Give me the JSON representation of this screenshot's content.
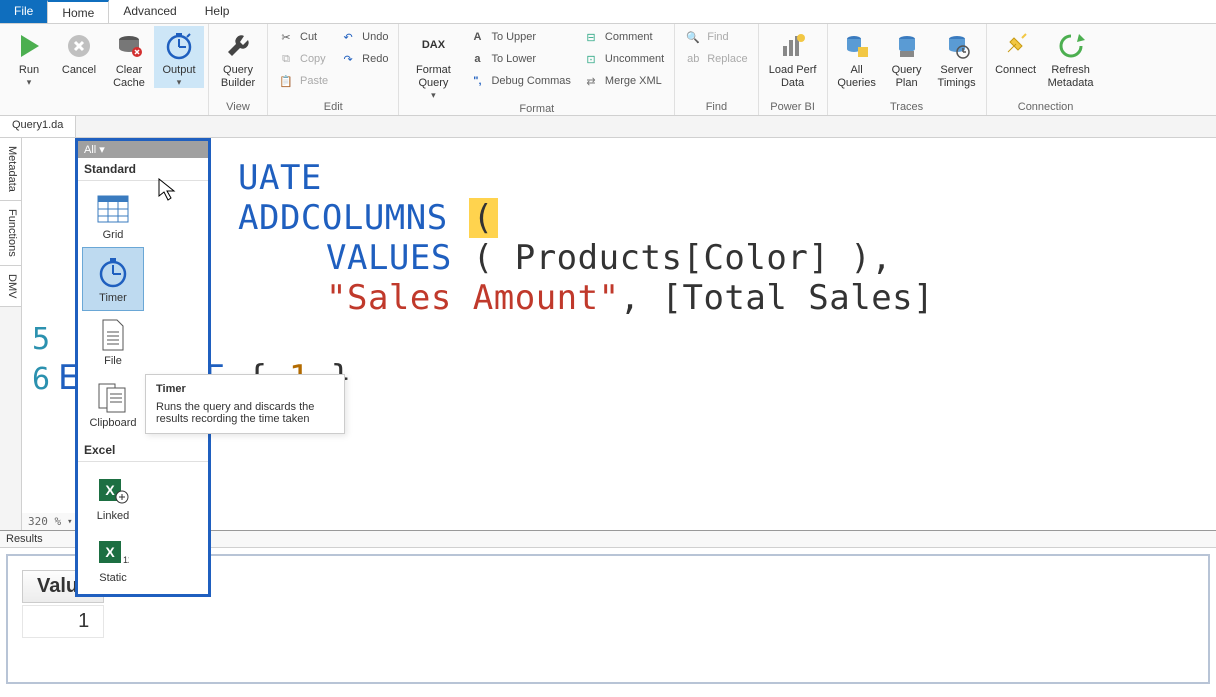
{
  "menu": {
    "file": "File",
    "home": "Home",
    "advanced": "Advanced",
    "help": "Help"
  },
  "ribbon": {
    "run": "Run",
    "cancel": "Cancel",
    "clear_cache": "Clear\nCache",
    "output": "Output",
    "query_builder": "Query\nBuilder",
    "view_group": "View",
    "cut": "Cut",
    "copy": "Copy",
    "paste": "Paste",
    "undo": "Undo",
    "redo": "Redo",
    "edit_group": "Edit",
    "format_query": "Format\nQuery",
    "to_upper": "To Upper",
    "to_lower": "To Lower",
    "debug_commas": "Debug Commas",
    "comment": "Comment",
    "uncomment": "Uncomment",
    "merge_xml": "Merge XML",
    "format_group": "Format",
    "find": "Find",
    "replace": "Replace",
    "find_group": "Find",
    "load_perf": "Load Perf\nData",
    "powerbi_group": "Power BI",
    "all_queries": "All\nQueries",
    "query_plan": "Query\nPlan",
    "server_timings": "Server\nTimings",
    "traces_group": "Traces",
    "connect": "Connect",
    "refresh_meta": "Refresh\nMetadata",
    "connection_group": "Connection"
  },
  "dropdown": {
    "all": "All ▾",
    "standard": "Standard",
    "grid": "Grid",
    "timer": "Timer",
    "file": "File",
    "clipboard": "Clipboard",
    "excel": "Excel",
    "linked": "Linked",
    "static": "Static"
  },
  "tooltip": {
    "title": "Timer",
    "body": "Runs the query and discards the results recording the time taken"
  },
  "tabs": {
    "query1": "Query1.da"
  },
  "side": {
    "metadata": "Metadata",
    "functions": "Functions",
    "dmv": "DMV"
  },
  "code": {
    "l1_uate": "UATE",
    "l2_addcolumns": "ADDCOLUMNS",
    "l3_values": "VALUES",
    "l3_rest": " ( Products[Color] ),",
    "l4_str": "\"Sales Amount\"",
    "l4_rest": ", [Total Sales]",
    "l6_eval": "EVALUATE",
    "l6_brace_open": " { ",
    "l6_num": "1",
    "l6_brace_close": " }"
  },
  "zoom": "320 %",
  "results": {
    "label": "Results",
    "col": "Value",
    "val": "1"
  }
}
